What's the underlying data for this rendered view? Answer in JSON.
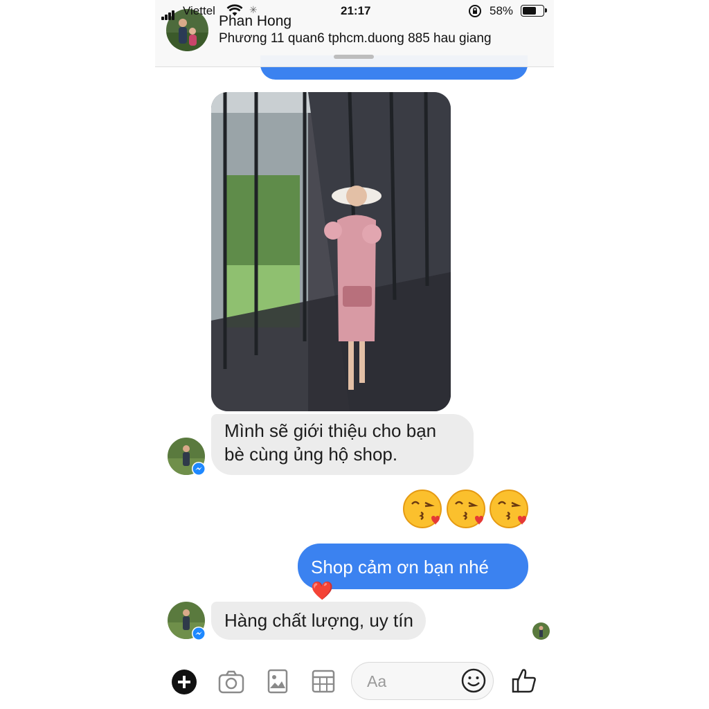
{
  "status": {
    "carrier": "Viettel",
    "time": "21:17",
    "battery_percent": "58%"
  },
  "header": {
    "contact_name": "Phan Hong",
    "contact_subtitle": "Phương 11 quan6 tphcm.duong 885 hau giang"
  },
  "messages": [
    {
      "direction": "incoming",
      "type": "image",
      "description_icon": "photo-woman-pink-dress"
    },
    {
      "direction": "incoming",
      "type": "text",
      "text": "Mình sẽ giới thiệu cho bạn bè cùng ủng hộ shop."
    },
    {
      "direction": "outgoing",
      "type": "emoji",
      "text": "😘😘😘"
    },
    {
      "direction": "outgoing",
      "type": "text",
      "text": "Shop cảm ơn bạn nhé ❤️"
    },
    {
      "direction": "incoming",
      "type": "text",
      "text": "Hàng chất lượng, uy tín"
    }
  ],
  "composer": {
    "placeholder": "Aa",
    "icons": [
      "plus-icon",
      "camera-icon",
      "image-icon",
      "sticker-grid-icon",
      "smile-icon",
      "thumbs-up-icon"
    ]
  },
  "colors": {
    "outgoing_bubble": "#3b82f0",
    "incoming_bubble": "#ececec",
    "messenger_badge": "#1e88ff"
  }
}
